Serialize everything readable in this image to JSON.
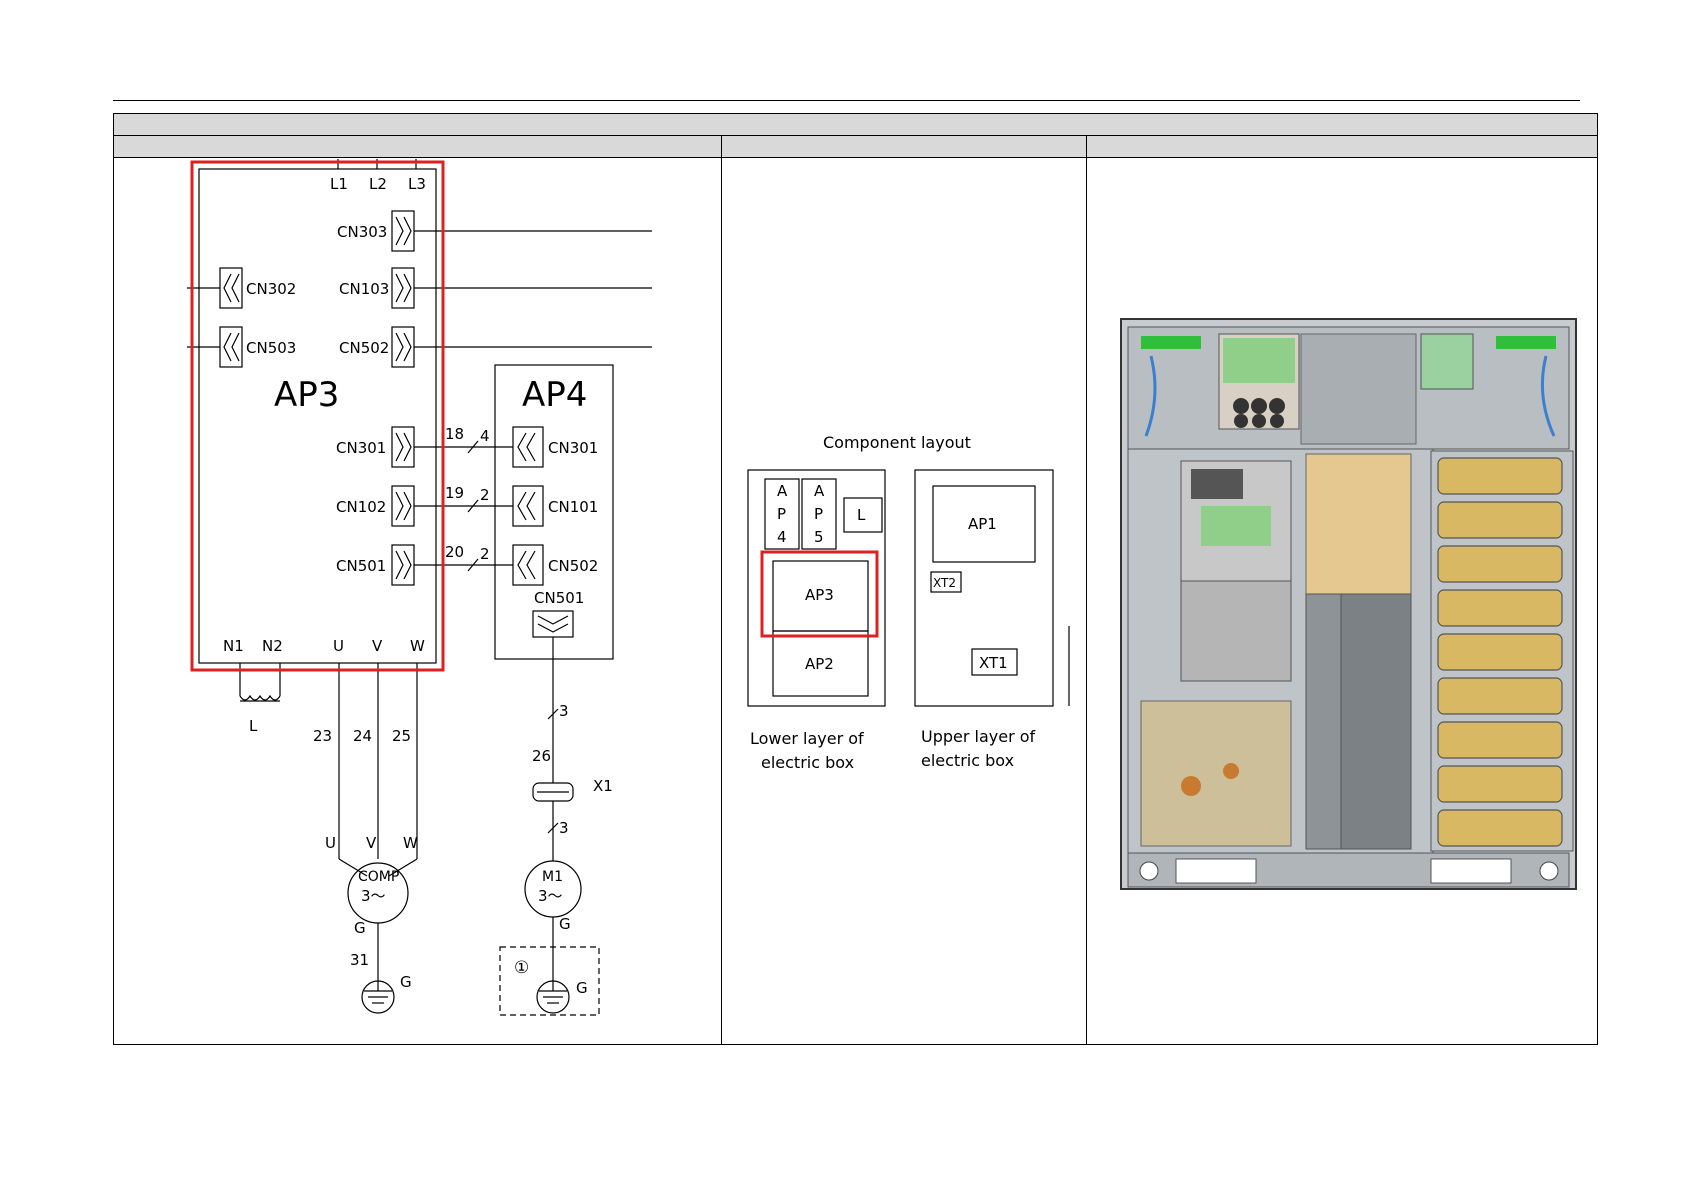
{
  "wiring": {
    "ap3": "AP3",
    "ap4": "AP4",
    "l1": "L1",
    "l2": "L2",
    "l3": "L3",
    "cn303": "CN303",
    "cn302": "CN302",
    "cn103": "CN103",
    "cn503": "CN503",
    "cn502_ap3": "CN502",
    "cn301_ap3": "CN301",
    "cn102": "CN102",
    "cn501_ap3": "CN501",
    "cn301_ap4": "CN301",
    "cn101": "CN101",
    "cn502_ap4": "CN502",
    "cn501_ap4": "CN501",
    "w18": "18",
    "w4": "4",
    "w19": "19",
    "w2a": "2",
    "w20": "20",
    "w2b": "2",
    "n1": "N1",
    "n2": "N2",
    "u": "U",
    "v": "V",
    "w": "W",
    "inductor": "L",
    "w23": "23",
    "w24": "24",
    "w25": "25",
    "mu": "U",
    "mv": "V",
    "mw": "W",
    "comp1": "COMP",
    "comp2": "3～",
    "g_comp": "G",
    "w31": "31",
    "g_earth1": "G",
    "w3a": "3",
    "w26": "26",
    "x1": "X1",
    "w3b": "3",
    "m1a": "M1",
    "m1b": "3～",
    "g_m1": "G",
    "circled1": "①",
    "g_earth2": "G"
  },
  "layout_diagram": {
    "title": "Component layout",
    "lower_letters_ap4": [
      "A",
      "P",
      "4"
    ],
    "lower_letters_ap5": [
      "A",
      "P",
      "5"
    ],
    "l_box": "L",
    "ap3": "AP3",
    "ap2": "AP2",
    "ap1": "AP1",
    "xt2": "XT2",
    "xt1": "XT1",
    "lower_caption_1": "Lower layer of",
    "lower_caption_2": "electric box",
    "upper_caption_1": "Upper layer of",
    "upper_caption_2": "electric box"
  },
  "colors": {
    "highlight": "#e02020",
    "header_bar": "#d9d9d9",
    "coil_gold": "#d8b862"
  }
}
